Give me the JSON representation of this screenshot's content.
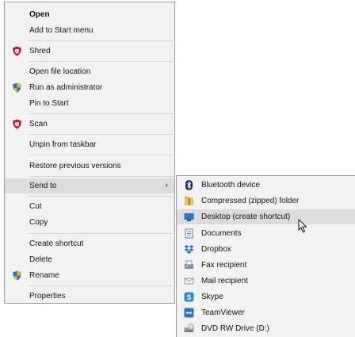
{
  "context_menu": {
    "items": [
      {
        "label": "Open",
        "icon": ""
      },
      {
        "label": "Add to Start menu",
        "icon": ""
      },
      {
        "label": "Shred",
        "icon": "shield-icon"
      },
      {
        "label": "Open file location",
        "icon": ""
      },
      {
        "label": "Run as administrator",
        "icon": "uac-shield-icon"
      },
      {
        "label": "Pin to Start",
        "icon": ""
      },
      {
        "label": "Scan",
        "icon": "shield-icon"
      },
      {
        "label": "Unpin from taskbar",
        "icon": ""
      },
      {
        "label": "Restore previous versions",
        "icon": ""
      },
      {
        "label": "Send to",
        "icon": ""
      },
      {
        "label": "Cut",
        "icon": ""
      },
      {
        "label": "Copy",
        "icon": ""
      },
      {
        "label": "Create shortcut",
        "icon": ""
      },
      {
        "label": "Delete",
        "icon": ""
      },
      {
        "label": "Rename",
        "icon": "uac-shield-icon"
      },
      {
        "label": "Properties",
        "icon": ""
      }
    ],
    "submenu_arrow": "›"
  },
  "send_to_menu": {
    "items": [
      {
        "label": "Bluetooth device",
        "icon": "bluetooth-icon"
      },
      {
        "label": "Compressed (zipped) folder",
        "icon": "zip-folder-icon"
      },
      {
        "label": "Desktop (create shortcut)",
        "icon": "desktop-icon"
      },
      {
        "label": "Documents",
        "icon": "documents-icon"
      },
      {
        "label": "Dropbox",
        "icon": "dropbox-icon"
      },
      {
        "label": "Fax recipient",
        "icon": "fax-icon"
      },
      {
        "label": "Mail recipient",
        "icon": "mail-icon"
      },
      {
        "label": "Skype",
        "icon": "skype-icon"
      },
      {
        "label": "TeamViewer",
        "icon": "teamviewer-icon"
      },
      {
        "label": "DVD RW Drive (D:)",
        "icon": "dvd-drive-icon"
      }
    ]
  },
  "colors": {
    "menu_bg": "#f2f2f2",
    "highlight": "#dcdcdc",
    "border": "#9c9c9c",
    "shield_red": "#b0202a",
    "accent_blue": "#2a6fc9"
  }
}
